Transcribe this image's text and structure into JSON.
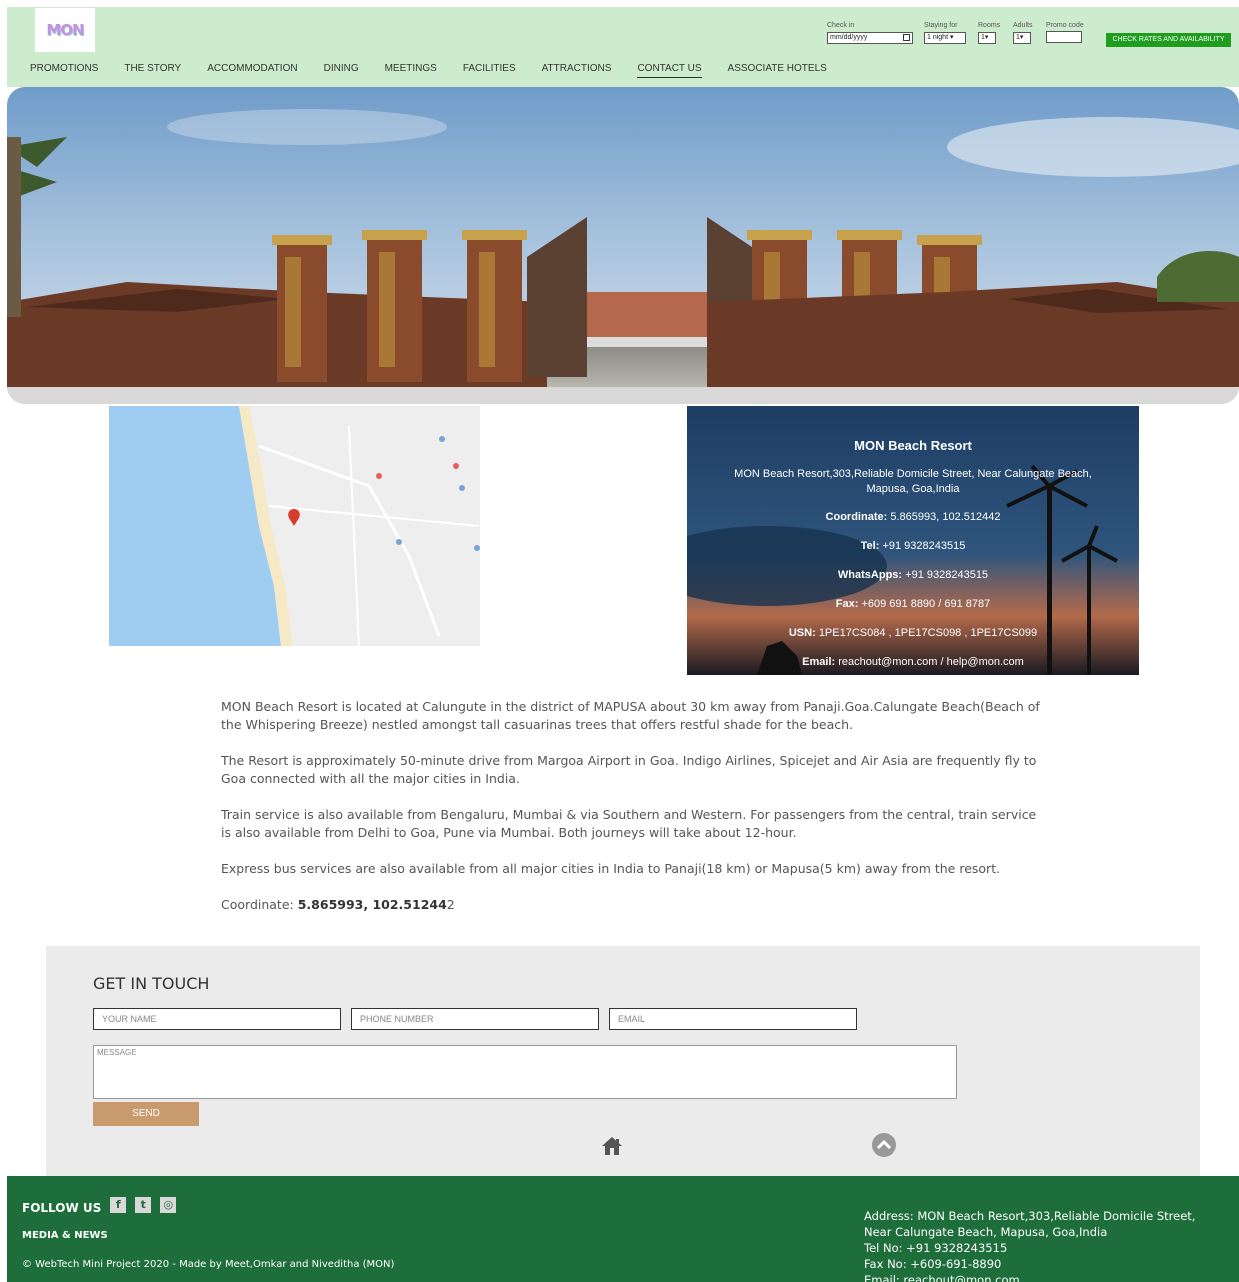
{
  "header": {
    "logo_text": "MON",
    "nav": [
      "PROMOTIONS",
      "THE STORY",
      "ACCOMMODATION",
      "DINING",
      "MEETINGS",
      "FACILITIES",
      "ATTRACTIONS",
      "CONTACT US",
      "ASSOCIATE HOTELS"
    ],
    "active_nav": "CONTACT US",
    "booking": {
      "checkin_label": "Check in",
      "checkin_value": "mm/dd/yyyy",
      "staying_label": "Staying for",
      "staying_value": "1 night",
      "rooms_label": "Rooms",
      "rooms_value": "1",
      "adults_label": "Adults",
      "adults_value": "1",
      "promo_label": "Promo code",
      "promo_value": "",
      "button_label": "CHECK RATES AND AVAILABILITY"
    }
  },
  "contact_card": {
    "title": "MON Beach Resort",
    "address": "MON Beach Resort,303,Reliable Domicile Street, Near Calungate Beach, Mapusa, Goa,India",
    "coordinate_label": "Coordinate:",
    "coordinate_value": "5.865993, 102.512442",
    "tel_label": "Tel:",
    "tel_value": "+91 9328243515",
    "whatsapp_label": "WhatsApps:",
    "whatsapp_value": "+91 9328243515",
    "fax_label": "Fax:",
    "fax_value": "+609 691 8890 / 691 8787",
    "usn_label": "USN:",
    "usn_value": "1PE17CS084 , 1PE17CS098 , 1PE17CS099",
    "email_label": "Email:",
    "email_value": "reachout@mon.com / help@mon.com"
  },
  "about": {
    "p1": "MON Beach Resort is located at Calungute in the district of MAPUSA about 30 km away from Panaji.Goa.Calungate Beach(Beach of the Whispering Breeze) nestled amongst tall casuarinas trees that offers restful shade for the beach.",
    "p2": "The Resort is approximately 50-minute drive from Margoa Airport in Goa. Indigo Airlines, Spicejet and Air Asia are frequently fly to Goa connected with all the major cities in India.",
    "p3": "Train service is also available from Bengaluru, Mumbai & via Southern and Western. For passengers from the central, train service is also available from Delhi to Goa, Pune via Mumbai. Both journeys will take about 12-hour.",
    "p4": "Express bus services are also available from all major cities in India to Panaji(18 km) or Mapusa(5 km) away from the resort.",
    "coord_label": "Coordinate:",
    "coord_value": "5.865993, 102.51244",
    "coord_tail": "2"
  },
  "touch": {
    "title": "GET IN TOUCH",
    "name_placeholder": "YOUR NAME",
    "phone_placeholder": "PHONE NUMBER",
    "email_placeholder": "EMAIL",
    "message_placeholder": "MESSAGE",
    "send_label": "SEND"
  },
  "footer": {
    "follow_label": "FOLLOW US",
    "media_label": "MEDIA & NEWS",
    "copyright": "© WebTech Mini Project 2020 - Made by Meet,Omkar and Niveditha (MON)",
    "address": "Address: MON Beach Resort,303,Reliable Domicile Street, Near Calungate Beach, Mapusa, Goa,India",
    "tel": "Tel No: +91 9328243515",
    "fax": "Fax No: +609-691-8890",
    "email": "Email: reachout@mon.com"
  },
  "colors": {
    "header_bg": "#cdeccd",
    "check_button": "#1f9d1f",
    "footer_bg": "#1e6e3b",
    "send_button": "#c89a6e"
  }
}
